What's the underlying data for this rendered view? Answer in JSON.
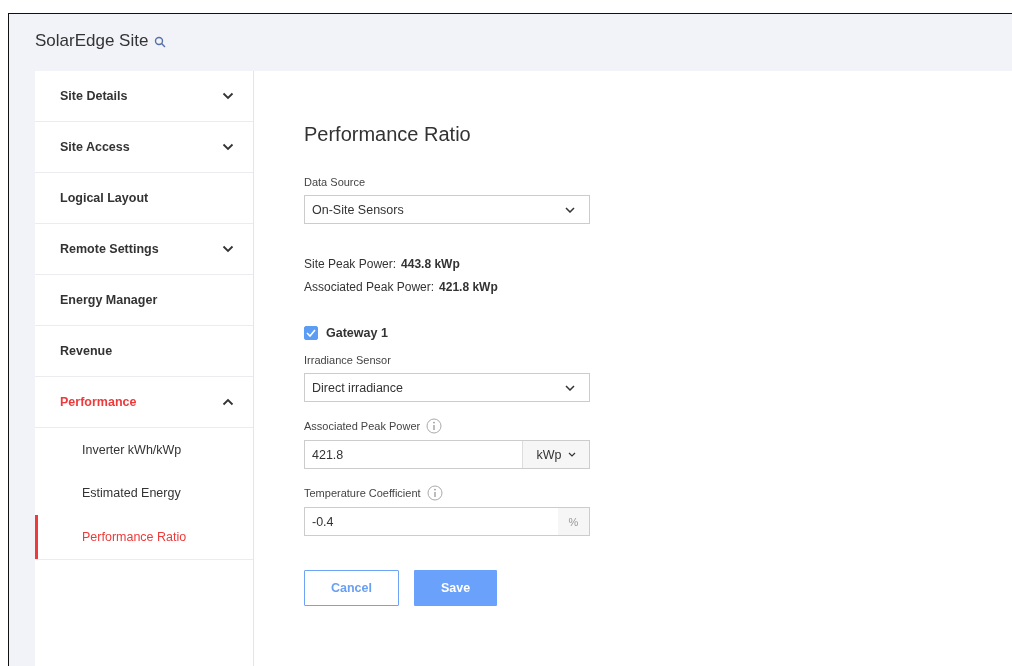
{
  "header": {
    "title": "SolarEdge Site"
  },
  "sidebar": {
    "items": [
      {
        "label": "Site Details",
        "expanded": false,
        "selected": false
      },
      {
        "label": "Site Access",
        "expanded": false,
        "selected": false
      },
      {
        "label": "Logical Layout",
        "selected": false
      },
      {
        "label": "Remote Settings",
        "expanded": false,
        "selected": false
      },
      {
        "label": "Energy Manager",
        "selected": false
      },
      {
        "label": "Revenue",
        "selected": false
      },
      {
        "label": "Performance",
        "expanded": true,
        "selected": true,
        "children": [
          {
            "label": "Inverter kWh/kWp",
            "selected": false
          },
          {
            "label": "Estimated Energy",
            "selected": false
          },
          {
            "label": "Performance Ratio",
            "selected": true
          }
        ]
      }
    ]
  },
  "page": {
    "title": "Performance Ratio",
    "data_source": {
      "label": "Data Source",
      "value": "On-Site Sensors"
    },
    "facts": [
      {
        "label": "Site Peak Power:",
        "value": "443.8 kWp"
      },
      {
        "label": "Associated Peak Power:",
        "value": "421.8 kWp"
      }
    ],
    "gateway": {
      "label": "Gateway 1",
      "checked": true
    },
    "irradiance_sensor": {
      "label": "Irradiance Sensor",
      "value": "Direct irradiance"
    },
    "associated_peak_power": {
      "label": "Associated Peak Power",
      "value": "421.8",
      "unit": "kWp"
    },
    "temperature_coefficient": {
      "label": "Temperature Coefficient",
      "value": "-0.4",
      "unit": "%"
    },
    "buttons": [
      {
        "label": "Cancel",
        "kind": "secondary"
      },
      {
        "label": "Save",
        "kind": "primary"
      }
    ]
  }
}
